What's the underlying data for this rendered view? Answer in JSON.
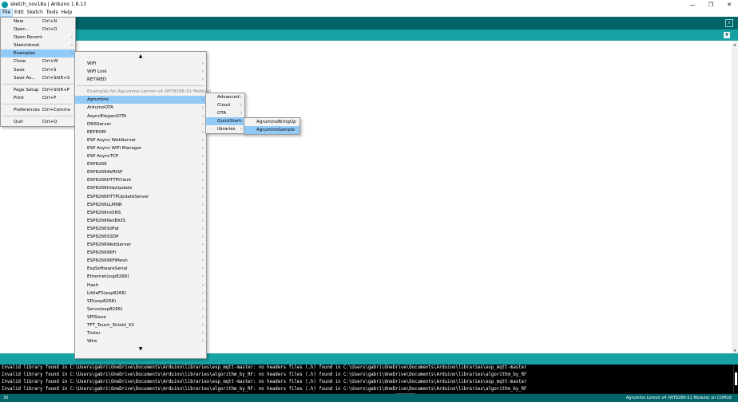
{
  "window": {
    "title": "sketch_nov18a | Arduino 1.8.13",
    "controls": {
      "minimize": "—",
      "maximize": "❐",
      "close": "✕"
    }
  },
  "menubar": [
    "File",
    "Edit",
    "Sketch",
    "Tools",
    "Help"
  ],
  "file_menu": {
    "groups": [
      [
        {
          "label": "New",
          "shortcut": "Ctrl+N"
        },
        {
          "label": "Open...",
          "shortcut": "Ctrl+O"
        },
        {
          "label": "Open Recent",
          "submenu": true
        },
        {
          "label": "Sketchbook",
          "submenu": true
        },
        {
          "label": "Examples",
          "submenu": true,
          "highlighted": true
        },
        {
          "label": "Close",
          "shortcut": "Ctrl+W"
        },
        {
          "label": "Save",
          "shortcut": "Ctrl+S"
        },
        {
          "label": "Save As...",
          "shortcut": "Ctrl+Shift+S"
        }
      ],
      [
        {
          "label": "Page Setup",
          "shortcut": "Ctrl+Shift+P"
        },
        {
          "label": "Print",
          "shortcut": "Ctrl+P"
        }
      ],
      [
        {
          "label": "Preferences",
          "shortcut": "Ctrl+Comma"
        }
      ],
      [
        {
          "label": "Quit",
          "shortcut": "Ctrl+Q"
        }
      ]
    ]
  },
  "examples_menu": {
    "scroll_up": "▲",
    "scroll_down": "▼",
    "top_items": [
      "WiFi",
      "WiFi Link",
      "RETIRED"
    ],
    "section_header": "Examples for Agrumino Lemon v4 (WT8266-S1 Module)",
    "items": [
      "Agrumino",
      "ArduinoOTA",
      "AsyncElegantOTA",
      "DNSServer",
      "EEPROM",
      "ESP Async WebServer",
      "ESP Async WiFi Manager",
      "ESP AsyncTCP",
      "ESP8266",
      "ESP8266AVRISP",
      "ESP8266HTTPClient",
      "ESP8266httpUpdate",
      "ESP8266HTTPUpdateServer",
      "ESP8266LLMNR",
      "ESP8266mDNS",
      "ESP8266NetBIOS",
      "ESP8266SdFat",
      "ESP8266SSDP",
      "ESP8266WebServer",
      "ESP8266WiFi",
      "ESP8266WiFiMesh",
      "EspSoftwareSerial",
      "Ethernet(esp8266)",
      "Hash",
      "LittleFS(esp8266)",
      "SD(esp8266)",
      "Servo(esp8266)",
      "SPISlave",
      "TFT_Touch_Shield_V2",
      "Ticker",
      "Wire"
    ],
    "highlighted": "Agrumino"
  },
  "agrumino_menu": {
    "items": [
      "Advanced",
      "Cloud",
      "OTA",
      "QuickStart",
      "libraries"
    ],
    "highlighted": "QuickStart"
  },
  "quickstart_menu": {
    "items": [
      "AgruminoBringUp",
      "AgruminoSample"
    ],
    "highlighted": "AgruminoSample"
  },
  "console": {
    "lines": [
      "Invalid library found in C:\\Users\\gabri\\OneDrive\\Documents\\Arduino\\libraries\\esp_mqtt-master: no headers files (.h) found in C:\\Users\\gabri\\OneDrive\\Documents\\Arduino\\libraries\\esp_mqtt-master",
      "Invalid library found in C:\\Users\\gabri\\OneDrive\\Documents\\Arduino\\libraries\\algorithm_by_RF: no headers files (.h) found in C:\\Users\\gabri\\OneDrive\\Documents\\Arduino\\libraries\\algorithm_by_RF",
      "Invalid library found in C:\\Users\\gabri\\OneDrive\\Documents\\Arduino\\libraries\\esp_mqtt-master: no headers files (.h) found in C:\\Users\\gabri\\OneDrive\\Documents\\Arduino\\libraries\\esp_mqtt-master",
      "Invalid library found in C:\\Users\\gabri\\OneDrive\\Documents\\Arduino\\libraries\\algorithm_by_RF: no headers files (.h) found in C:\\Users\\gabri\\OneDrive\\Documents\\Arduino\\libraries\\algorithm_by_RF"
    ]
  },
  "statusbar": {
    "line_number": "30",
    "board": "Agrumino Lemon v4 (WT8266-S1 Module) on COM18"
  },
  "icons": {
    "submenu_arrow": "›",
    "serial_monitor": "⌕",
    "tab_menu": "▼"
  },
  "colors": {
    "toolbar": "#006468",
    "tabbar": "#17a1a5",
    "menu_highlight": "#91c9f7",
    "console_bg": "#000000"
  }
}
